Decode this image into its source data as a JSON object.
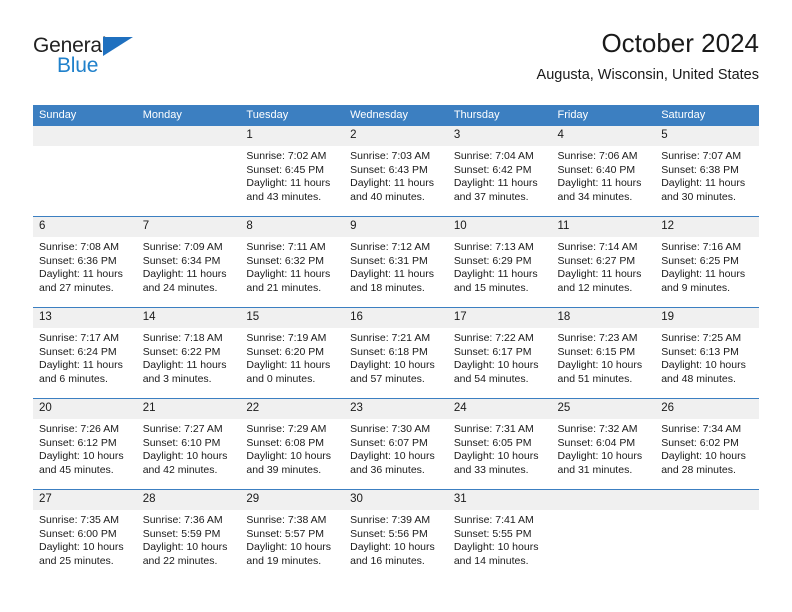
{
  "brand": {
    "name_top": "General",
    "name_bottom": "Blue",
    "accent_color": "#2081cb",
    "triangle_color": "#1f70bf"
  },
  "header": {
    "title": "October 2024",
    "subtitle": "Augusta, Wisconsin, United States"
  },
  "theme": {
    "header_row_bg": "#3c7fc1",
    "daynum_bg": "#f0f0f0",
    "row_divider": "#3c7fc1",
    "text": "#1a1a1a"
  },
  "weekdays": [
    "Sunday",
    "Monday",
    "Tuesday",
    "Wednesday",
    "Thursday",
    "Friday",
    "Saturday"
  ],
  "labels": {
    "sunrise_prefix": "Sunrise:",
    "sunset_prefix": "Sunset:",
    "daylight_prefix": "Daylight:"
  },
  "weeks": [
    [
      {
        "day": "",
        "blank": true,
        "sunrise": "",
        "sunset": "",
        "daylight": ""
      },
      {
        "day": "",
        "blank": true,
        "sunrise": "",
        "sunset": "",
        "daylight": ""
      },
      {
        "day": "1",
        "blank": false,
        "sunrise": "Sunrise: 7:02 AM",
        "sunset": "Sunset: 6:45 PM",
        "daylight": "Daylight: 11 hours and 43 minutes."
      },
      {
        "day": "2",
        "blank": false,
        "sunrise": "Sunrise: 7:03 AM",
        "sunset": "Sunset: 6:43 PM",
        "daylight": "Daylight: 11 hours and 40 minutes."
      },
      {
        "day": "3",
        "blank": false,
        "sunrise": "Sunrise: 7:04 AM",
        "sunset": "Sunset: 6:42 PM",
        "daylight": "Daylight: 11 hours and 37 minutes."
      },
      {
        "day": "4",
        "blank": false,
        "sunrise": "Sunrise: 7:06 AM",
        "sunset": "Sunset: 6:40 PM",
        "daylight": "Daylight: 11 hours and 34 minutes."
      },
      {
        "day": "5",
        "blank": false,
        "sunrise": "Sunrise: 7:07 AM",
        "sunset": "Sunset: 6:38 PM",
        "daylight": "Daylight: 11 hours and 30 minutes."
      }
    ],
    [
      {
        "day": "6",
        "blank": false,
        "sunrise": "Sunrise: 7:08 AM",
        "sunset": "Sunset: 6:36 PM",
        "daylight": "Daylight: 11 hours and 27 minutes."
      },
      {
        "day": "7",
        "blank": false,
        "sunrise": "Sunrise: 7:09 AM",
        "sunset": "Sunset: 6:34 PM",
        "daylight": "Daylight: 11 hours and 24 minutes."
      },
      {
        "day": "8",
        "blank": false,
        "sunrise": "Sunrise: 7:11 AM",
        "sunset": "Sunset: 6:32 PM",
        "daylight": "Daylight: 11 hours and 21 minutes."
      },
      {
        "day": "9",
        "blank": false,
        "sunrise": "Sunrise: 7:12 AM",
        "sunset": "Sunset: 6:31 PM",
        "daylight": "Daylight: 11 hours and 18 minutes."
      },
      {
        "day": "10",
        "blank": false,
        "sunrise": "Sunrise: 7:13 AM",
        "sunset": "Sunset: 6:29 PM",
        "daylight": "Daylight: 11 hours and 15 minutes."
      },
      {
        "day": "11",
        "blank": false,
        "sunrise": "Sunrise: 7:14 AM",
        "sunset": "Sunset: 6:27 PM",
        "daylight": "Daylight: 11 hours and 12 minutes."
      },
      {
        "day": "12",
        "blank": false,
        "sunrise": "Sunrise: 7:16 AM",
        "sunset": "Sunset: 6:25 PM",
        "daylight": "Daylight: 11 hours and 9 minutes."
      }
    ],
    [
      {
        "day": "13",
        "blank": false,
        "sunrise": "Sunrise: 7:17 AM",
        "sunset": "Sunset: 6:24 PM",
        "daylight": "Daylight: 11 hours and 6 minutes."
      },
      {
        "day": "14",
        "blank": false,
        "sunrise": "Sunrise: 7:18 AM",
        "sunset": "Sunset: 6:22 PM",
        "daylight": "Daylight: 11 hours and 3 minutes."
      },
      {
        "day": "15",
        "blank": false,
        "sunrise": "Sunrise: 7:19 AM",
        "sunset": "Sunset: 6:20 PM",
        "daylight": "Daylight: 11 hours and 0 minutes."
      },
      {
        "day": "16",
        "blank": false,
        "sunrise": "Sunrise: 7:21 AM",
        "sunset": "Sunset: 6:18 PM",
        "daylight": "Daylight: 10 hours and 57 minutes."
      },
      {
        "day": "17",
        "blank": false,
        "sunrise": "Sunrise: 7:22 AM",
        "sunset": "Sunset: 6:17 PM",
        "daylight": "Daylight: 10 hours and 54 minutes."
      },
      {
        "day": "18",
        "blank": false,
        "sunrise": "Sunrise: 7:23 AM",
        "sunset": "Sunset: 6:15 PM",
        "daylight": "Daylight: 10 hours and 51 minutes."
      },
      {
        "day": "19",
        "blank": false,
        "sunrise": "Sunrise: 7:25 AM",
        "sunset": "Sunset: 6:13 PM",
        "daylight": "Daylight: 10 hours and 48 minutes."
      }
    ],
    [
      {
        "day": "20",
        "blank": false,
        "sunrise": "Sunrise: 7:26 AM",
        "sunset": "Sunset: 6:12 PM",
        "daylight": "Daylight: 10 hours and 45 minutes."
      },
      {
        "day": "21",
        "blank": false,
        "sunrise": "Sunrise: 7:27 AM",
        "sunset": "Sunset: 6:10 PM",
        "daylight": "Daylight: 10 hours and 42 minutes."
      },
      {
        "day": "22",
        "blank": false,
        "sunrise": "Sunrise: 7:29 AM",
        "sunset": "Sunset: 6:08 PM",
        "daylight": "Daylight: 10 hours and 39 minutes."
      },
      {
        "day": "23",
        "blank": false,
        "sunrise": "Sunrise: 7:30 AM",
        "sunset": "Sunset: 6:07 PM",
        "daylight": "Daylight: 10 hours and 36 minutes."
      },
      {
        "day": "24",
        "blank": false,
        "sunrise": "Sunrise: 7:31 AM",
        "sunset": "Sunset: 6:05 PM",
        "daylight": "Daylight: 10 hours and 33 minutes."
      },
      {
        "day": "25",
        "blank": false,
        "sunrise": "Sunrise: 7:32 AM",
        "sunset": "Sunset: 6:04 PM",
        "daylight": "Daylight: 10 hours and 31 minutes."
      },
      {
        "day": "26",
        "blank": false,
        "sunrise": "Sunrise: 7:34 AM",
        "sunset": "Sunset: 6:02 PM",
        "daylight": "Daylight: 10 hours and 28 minutes."
      }
    ],
    [
      {
        "day": "27",
        "blank": false,
        "sunrise": "Sunrise: 7:35 AM",
        "sunset": "Sunset: 6:00 PM",
        "daylight": "Daylight: 10 hours and 25 minutes."
      },
      {
        "day": "28",
        "blank": false,
        "sunrise": "Sunrise: 7:36 AM",
        "sunset": "Sunset: 5:59 PM",
        "daylight": "Daylight: 10 hours and 22 minutes."
      },
      {
        "day": "29",
        "blank": false,
        "sunrise": "Sunrise: 7:38 AM",
        "sunset": "Sunset: 5:57 PM",
        "daylight": "Daylight: 10 hours and 19 minutes."
      },
      {
        "day": "30",
        "blank": false,
        "sunrise": "Sunrise: 7:39 AM",
        "sunset": "Sunset: 5:56 PM",
        "daylight": "Daylight: 10 hours and 16 minutes."
      },
      {
        "day": "31",
        "blank": false,
        "sunrise": "Sunrise: 7:41 AM",
        "sunset": "Sunset: 5:55 PM",
        "daylight": "Daylight: 10 hours and 14 minutes."
      },
      {
        "day": "",
        "blank": true,
        "sunrise": "",
        "sunset": "",
        "daylight": ""
      },
      {
        "day": "",
        "blank": true,
        "sunrise": "",
        "sunset": "",
        "daylight": ""
      }
    ]
  ]
}
